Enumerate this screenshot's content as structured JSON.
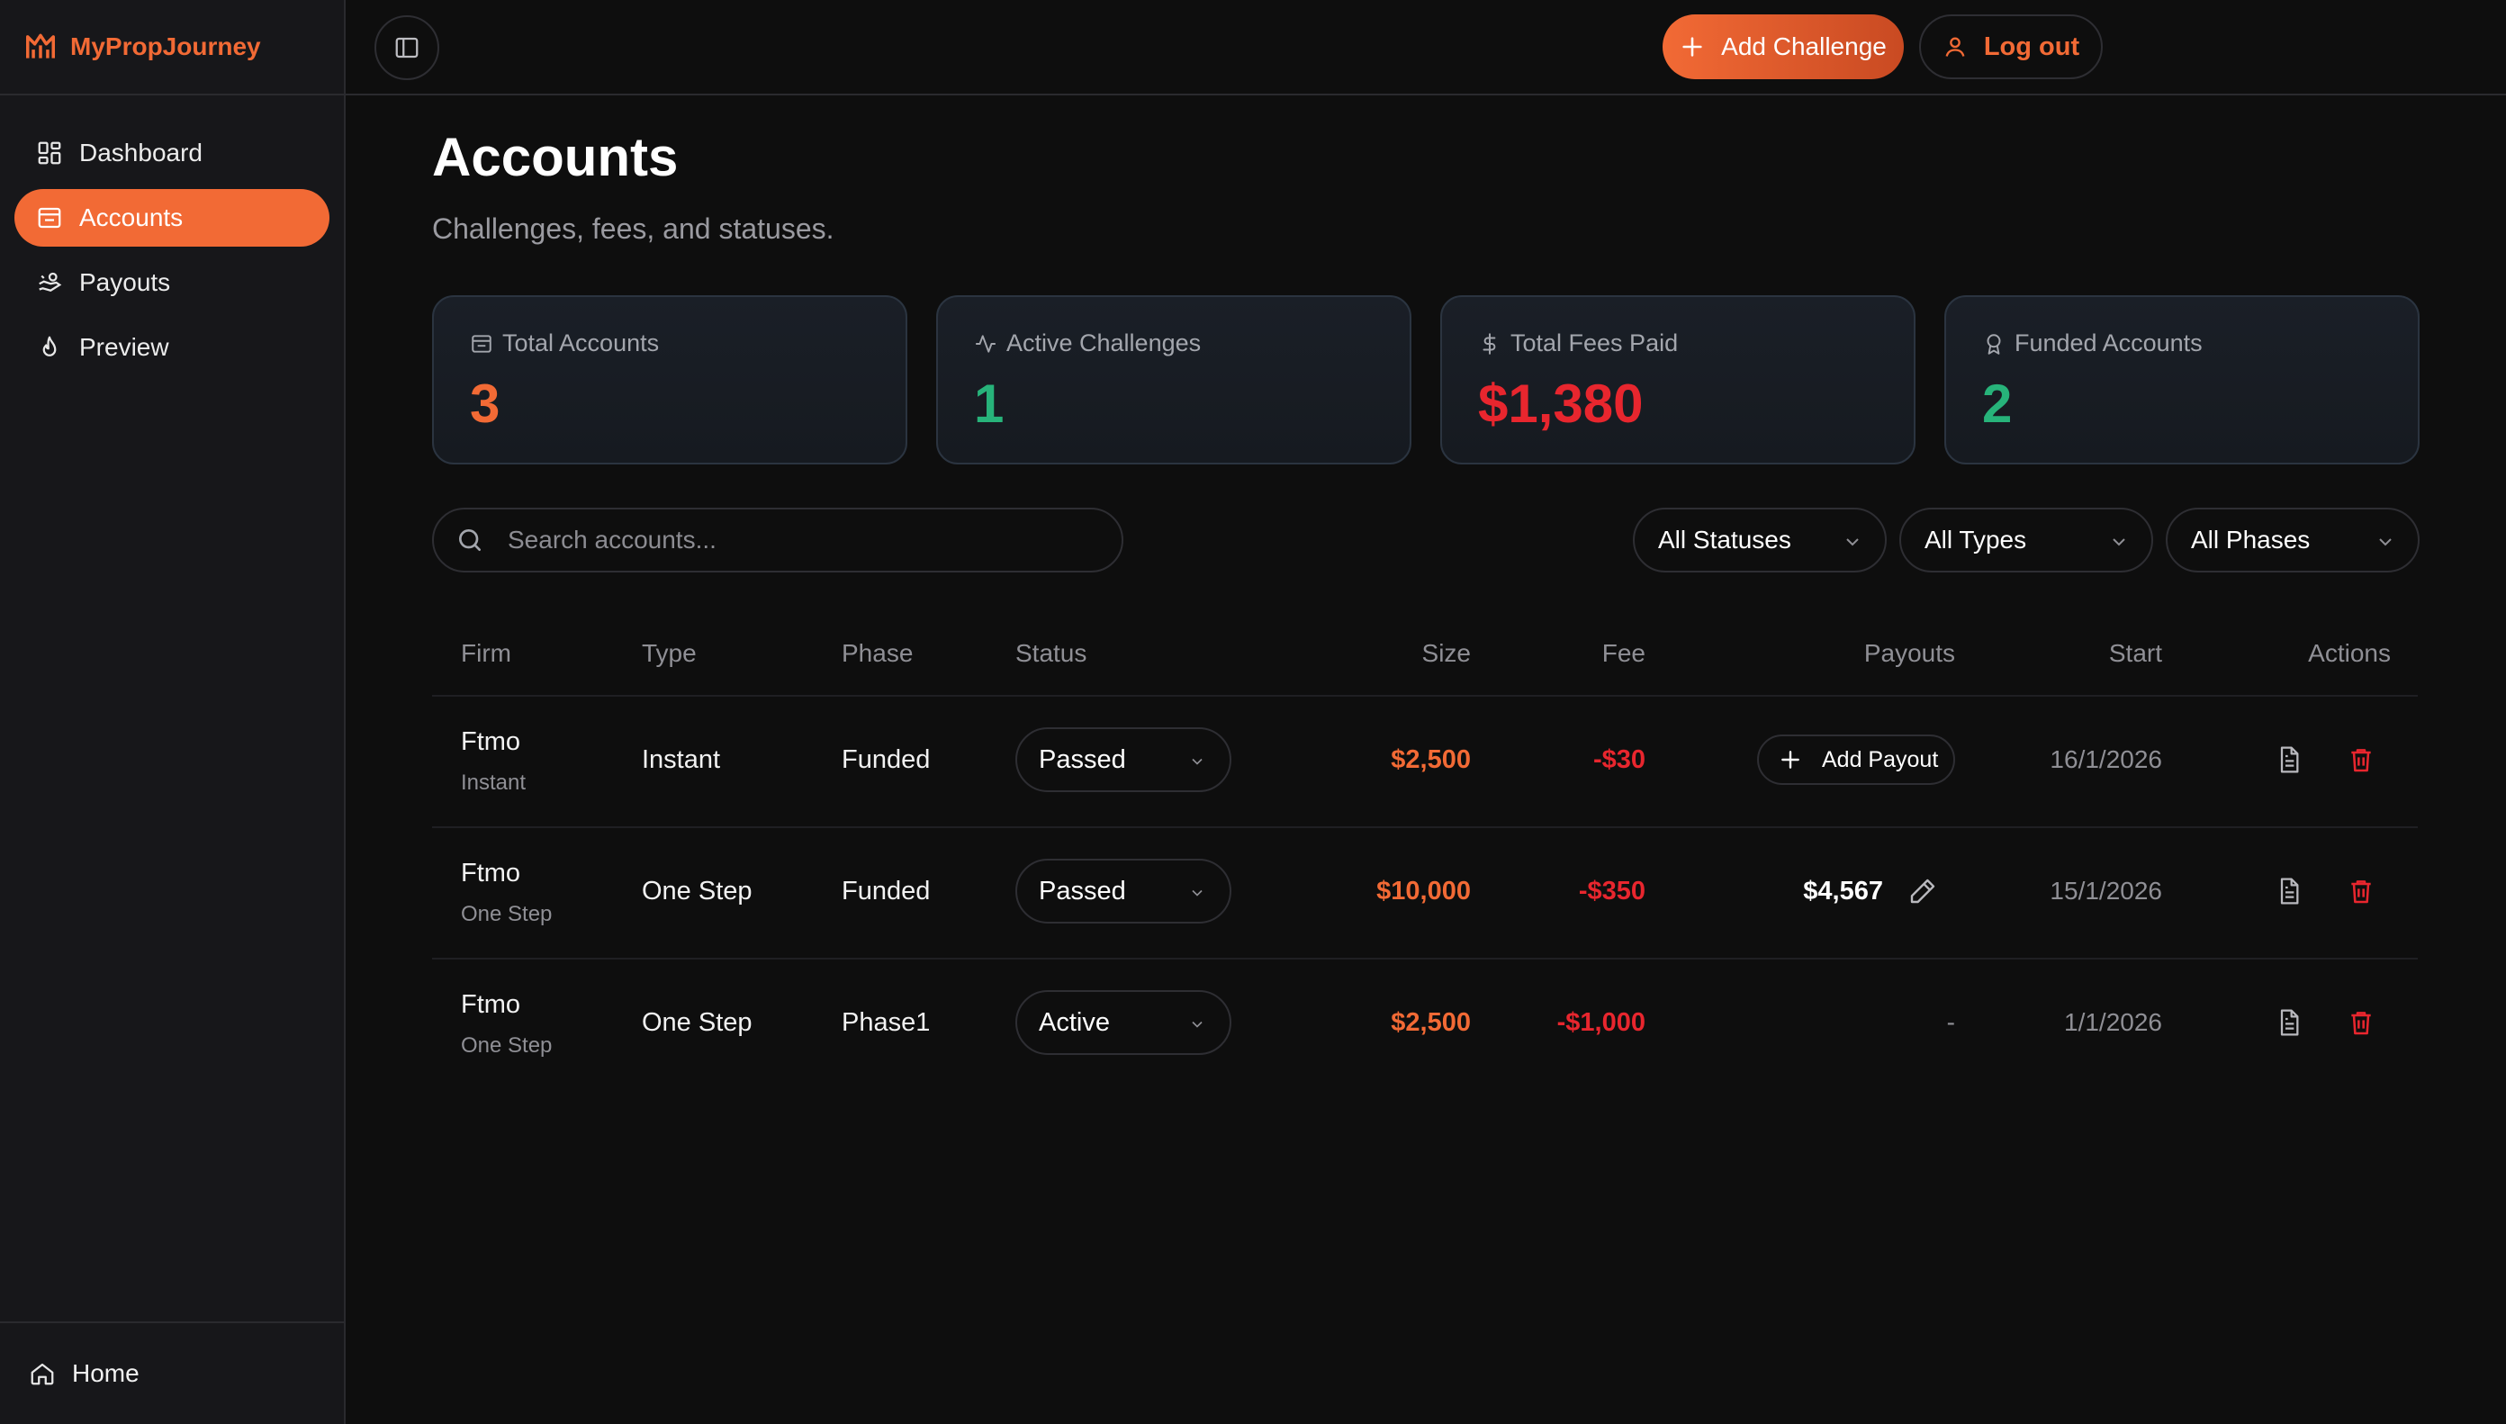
{
  "brand": {
    "name": "MyPropJourney"
  },
  "sidebar": {
    "items": [
      {
        "label": "Dashboard",
        "icon": "dashboard-icon"
      },
      {
        "label": "Accounts",
        "icon": "wallet-icon",
        "active": true
      },
      {
        "label": "Payouts",
        "icon": "hand-coins-icon"
      },
      {
        "label": "Preview",
        "icon": "flame-icon"
      }
    ],
    "footer": {
      "label": "Home",
      "icon": "home-icon"
    }
  },
  "topbar": {
    "add_label": "Add Challenge",
    "logout_label": "Log out"
  },
  "page": {
    "title": "Accounts",
    "subtitle": "Challenges, fees, and statuses."
  },
  "stats": [
    {
      "label": "Total Accounts",
      "value": "3",
      "color": "#f26a35"
    },
    {
      "label": "Active Challenges",
      "value": "1",
      "color": "#27b37a"
    },
    {
      "label": "Total Fees Paid",
      "value": "$1,380",
      "color": "#e8262e"
    },
    {
      "label": "Funded Accounts",
      "value": "2",
      "color": "#27b37a"
    }
  ],
  "search": {
    "placeholder": "Search accounts..."
  },
  "filters": {
    "status": "All Statuses",
    "type": "All Types",
    "phase": "All Phases"
  },
  "table": {
    "headers": {
      "firm": "Firm",
      "type": "Type",
      "phase": "Phase",
      "status": "Status",
      "size": "Size",
      "fee": "Fee",
      "payouts": "Payouts",
      "start": "Start",
      "actions": "Actions"
    },
    "rows": [
      {
        "firm": "Ftmo",
        "firm_sub": "Instant",
        "type": "Instant",
        "phase": "Funded",
        "status": "Passed",
        "size": "$2,500",
        "fee": "-$30",
        "payout_label": "Add Payout",
        "payout_value": "",
        "start": "16/1/2026"
      },
      {
        "firm": "Ftmo",
        "firm_sub": "One Step",
        "type": "One Step",
        "phase": "Funded",
        "status": "Passed",
        "size": "$10,000",
        "fee": "-$350",
        "payout_label": "",
        "payout_value": "$4,567",
        "start": "15/1/2026"
      },
      {
        "firm": "Ftmo",
        "firm_sub": "One Step",
        "type": "One Step",
        "phase": "Phase1",
        "status": "Active",
        "size": "$2,500",
        "fee": "-$1,000",
        "payout_label": "",
        "payout_value": "-",
        "start": "1/1/2026"
      }
    ]
  },
  "colors": {
    "accent": "#f26a35",
    "positive": "#27b37a",
    "negative": "#e8262e",
    "background": "#0e0e0e"
  }
}
